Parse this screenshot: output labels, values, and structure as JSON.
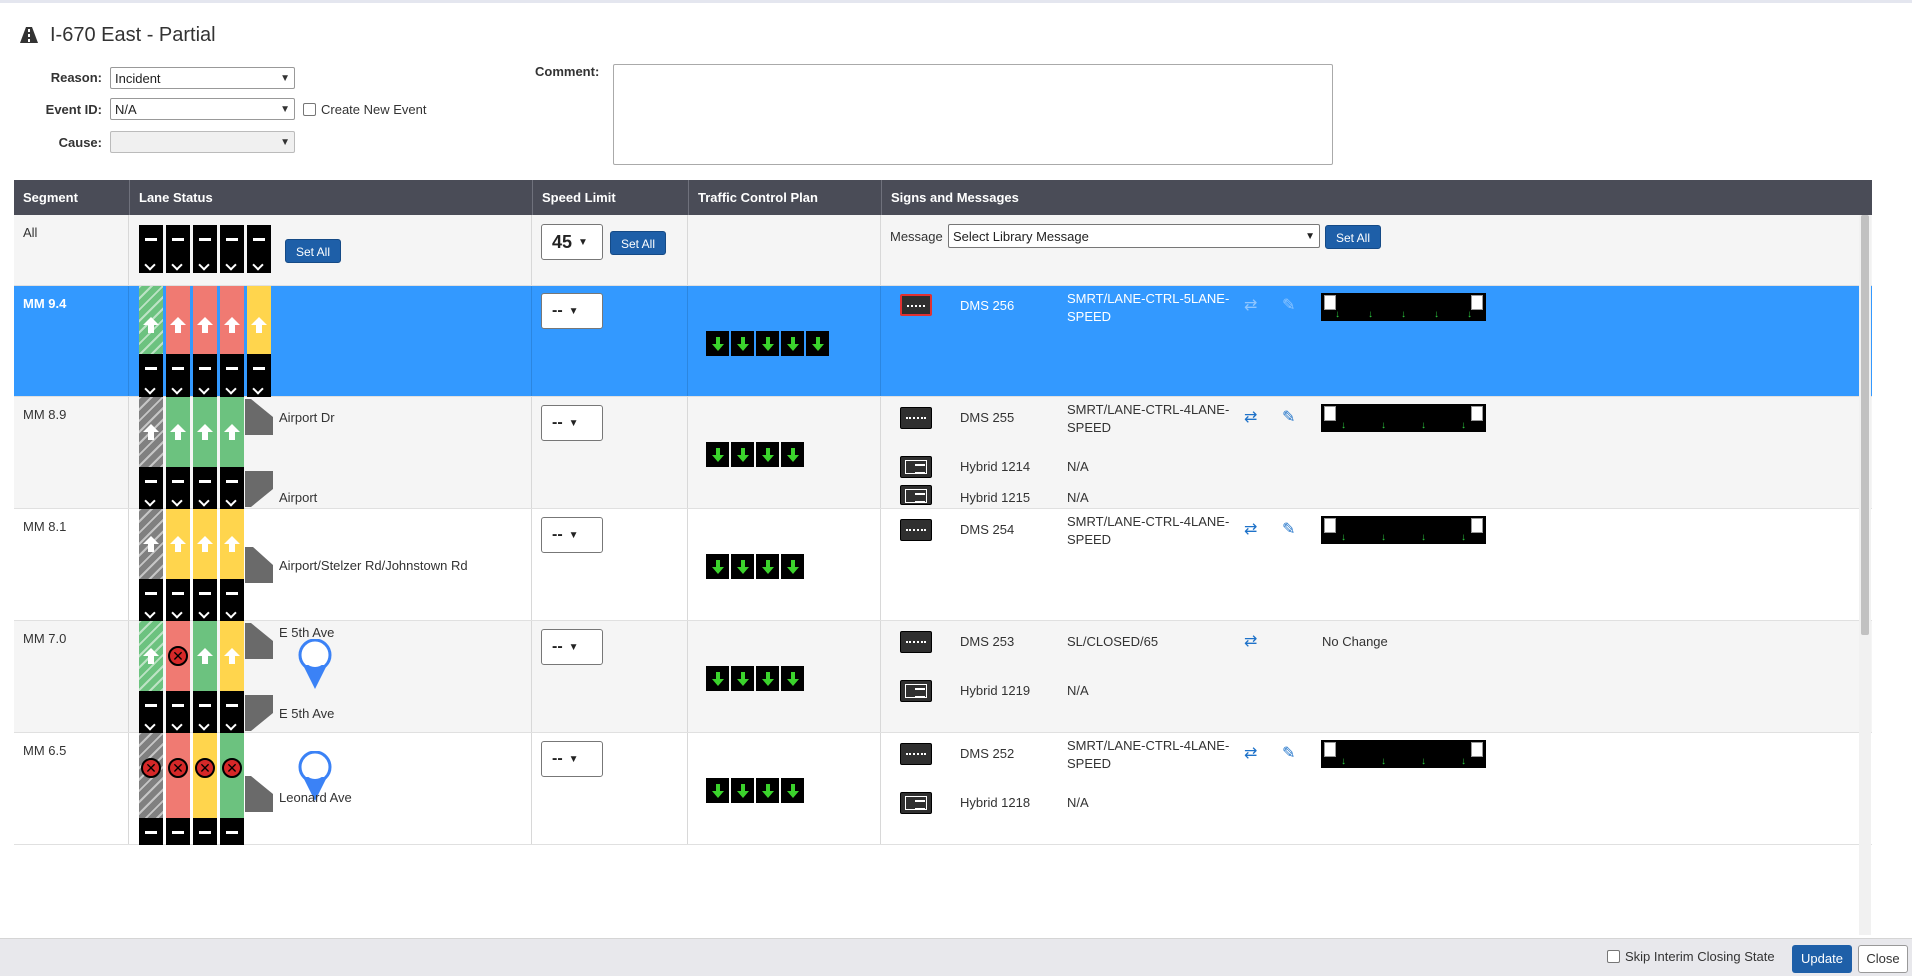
{
  "title": "I-670 East - Partial",
  "form": {
    "reason_label": "Reason:",
    "reason_value": "Incident",
    "event_label": "Event ID:",
    "event_value": "N/A",
    "create_event_label": "Create New Event",
    "cause_label": "Cause:",
    "cause_value": "",
    "comment_label": "Comment:"
  },
  "headers": {
    "segment": "Segment",
    "lane_status": "Lane Status",
    "speed_limit": "Speed Limit",
    "tcp": "Traffic Control Plan",
    "signs": "Signs and Messages"
  },
  "all_row": {
    "segment": "All",
    "set_all_lanes": "Set All",
    "speed": "45",
    "set_all_speed": "Set All",
    "message_label": "Message",
    "message_select": "Select Library Message",
    "set_all_msg": "Set All"
  },
  "rows": [
    {
      "segment": "MM 9.4",
      "speed": "--",
      "signs": [
        {
          "name": "DMS 256",
          "msg": "SMRT/LANE-CTRL-5LANE-SPEED"
        }
      ]
    },
    {
      "segment": "MM 8.9",
      "speed": "--",
      "label_top": "Airport Dr",
      "label_bottom": "Airport",
      "signs": [
        {
          "name": "DMS 255",
          "msg": "SMRT/LANE-CTRL-4LANE-SPEED"
        },
        {
          "name": "Hybrid 1214",
          "msg": "N/A"
        },
        {
          "name": "Hybrid 1215",
          "msg": "N/A"
        }
      ]
    },
    {
      "segment": "MM 8.1",
      "speed": "--",
      "label_top": "Airport/Stelzer Rd/Johnstown Rd",
      "signs": [
        {
          "name": "DMS 254",
          "msg": "SMRT/LANE-CTRL-4LANE-SPEED"
        }
      ]
    },
    {
      "segment": "MM 7.0",
      "speed": "--",
      "label_top": "E 5th Ave",
      "label_bottom": "E 5th Ave",
      "no_change": "No Change",
      "signs": [
        {
          "name": "DMS 253",
          "msg": "SL/CLOSED/65"
        },
        {
          "name": "Hybrid 1219",
          "msg": "N/A"
        }
      ]
    },
    {
      "segment": "MM 6.5",
      "speed": "--",
      "label_top": "Leonard Ave",
      "signs": [
        {
          "name": "DMS 252",
          "msg": "SMRT/LANE-CTRL-4LANE-SPEED"
        },
        {
          "name": "Hybrid 1218",
          "msg": "N/A"
        }
      ]
    }
  ],
  "footer": {
    "skip_label": "Skip Interim Closing State",
    "update": "Update",
    "close": "Close"
  },
  "colors": {
    "header_bg": "#4a4c57",
    "selected_row": "#3399ff",
    "button": "#1e5fa8",
    "lane_green": "#6cc27f",
    "lane_red": "#f07a72",
    "lane_yellow": "#ffd54d"
  },
  "icons": [
    "road-icon",
    "arrow-up-icon",
    "closed-x-icon",
    "chevron-down-icon",
    "swap-icon",
    "pencil-icon",
    "map-pin-icon",
    "dms-sign-icon",
    "hybrid-sign-icon",
    "down-arrow-icon"
  ]
}
